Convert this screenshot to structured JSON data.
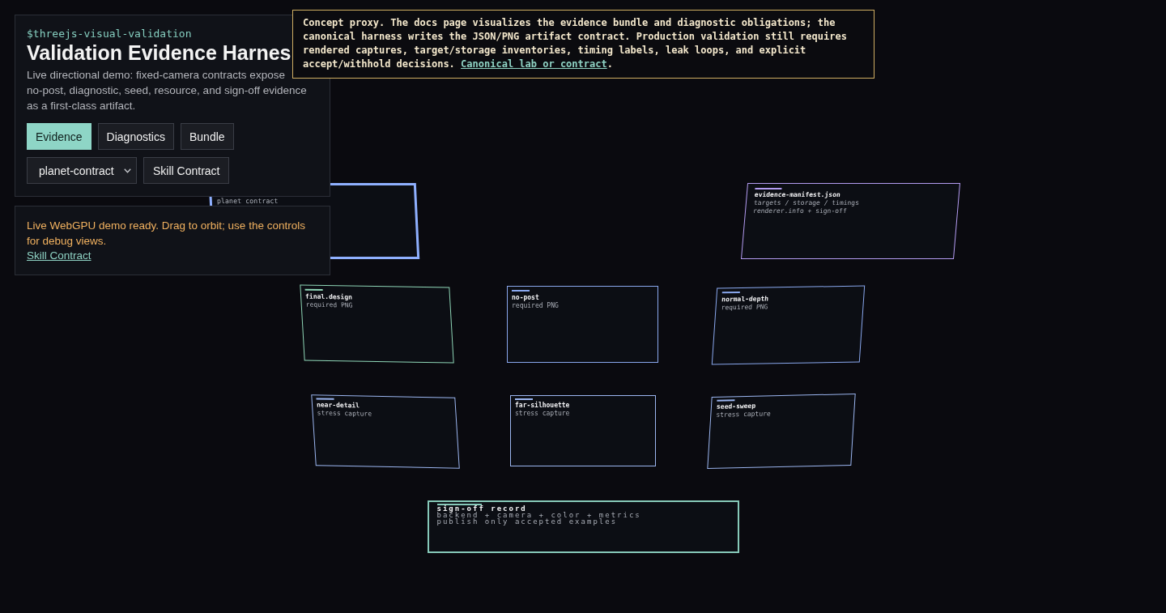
{
  "panel": {
    "eyebrow": "$threejs-visual-validation",
    "title": "Validation Evidence Harnes",
    "description_lines": [
      "Live directional demo: fixed-camera contracts expose",
      "no-post, diagnostic, seed, resource, and sign-off evidence",
      "as a first-class artifact."
    ],
    "view_buttons": [
      {
        "label": "Evidence",
        "selected": true
      },
      {
        "label": "Diagnostics",
        "selected": false
      },
      {
        "label": "Bundle",
        "selected": false
      }
    ],
    "contract_select": {
      "value": "planet-contract"
    },
    "contract_button": "Skill Contract"
  },
  "status": {
    "message": "Live WebGPU demo ready. Drag to orbit; use the controls for debug views.",
    "link": "Skill Contract"
  },
  "notice": {
    "text": "Concept proxy. The docs page visualizes the evidence bundle and diagnostic obligations; the canonical harness writes the JSON/PNG artifact contract. Production validation still requires rendered captures, target/storage inventories, timing labels, leak loops, and explicit accept/withhold decisions.",
    "link": "Canonical lab or contract",
    "trailing": "."
  },
  "scene": {
    "cards": [
      {
        "lines": [
          "planet contract"
        ],
        "color": "#8fb0ff"
      },
      {
        "title": "evidence-manifest.json",
        "lines": [
          "targets / storage / timings",
          "renderer.info + sign-off"
        ],
        "color": "#b49cf2"
      },
      {
        "title": "final.design",
        "lines": [
          "required PNG"
        ],
        "color": "#8fd6b6"
      },
      {
        "title": "no-post",
        "lines": [
          "required PNG"
        ],
        "color": "#8aa8ee"
      },
      {
        "title": "normal-depth",
        "lines": [
          "required PNG"
        ],
        "color": "#8aa8ee"
      },
      {
        "title": "near-detail",
        "lines": [
          "stress capture"
        ],
        "color": "#9cb6f0"
      },
      {
        "title": "far-silhouette",
        "lines": [
          "stress capture"
        ],
        "color": "#9cb6f0"
      },
      {
        "title": "seed-sweep",
        "lines": [
          "stress capture"
        ],
        "color": "#9cb6f0"
      },
      {
        "title": "sign-off record",
        "lines": [
          "backend + camera + color + metrics",
          "publish only accepted examples"
        ],
        "color": "#86c9b9"
      }
    ]
  }
}
